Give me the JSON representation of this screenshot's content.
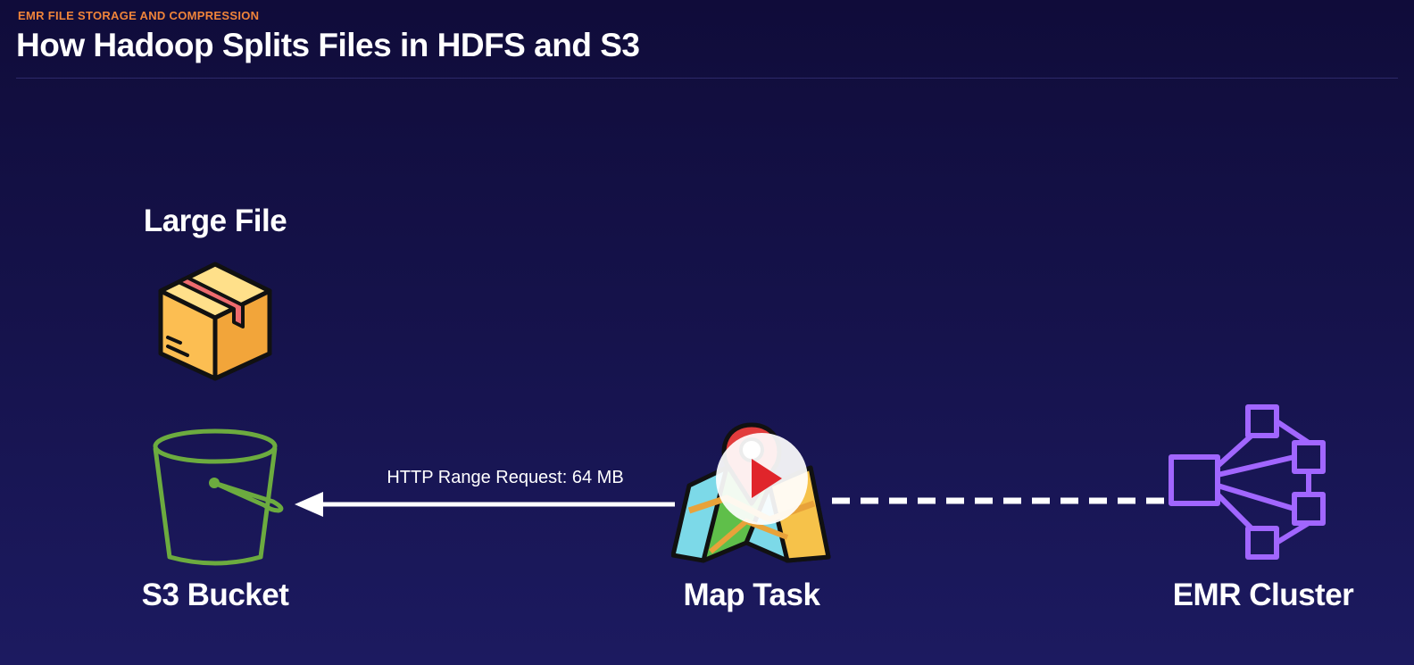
{
  "header": {
    "eyebrow": "EMR FILE STORAGE AND COMPRESSION",
    "title": "How Hadoop Splits Files in HDFS and S3"
  },
  "nodes": {
    "large_file": {
      "label": "Large File",
      "icon": "package-box-icon"
    },
    "s3_bucket": {
      "label": "S3 Bucket",
      "icon": "bucket-icon"
    },
    "map_task": {
      "label": "Map Task",
      "icon": "map-icon"
    },
    "emr_cluster": {
      "label": "EMR Cluster",
      "icon": "cluster-network-icon"
    }
  },
  "edges": {
    "map_to_s3": {
      "label": "HTTP Range Request: 64 MB",
      "style": "solid"
    },
    "emr_to_map": {
      "label": "",
      "style": "dashed"
    }
  },
  "overlay": {
    "play_icon": "play-icon"
  },
  "colors": {
    "accent": "#f0843a",
    "bucket": "#6cab3f",
    "cluster": "#a166ff",
    "play": "#e0252b"
  }
}
